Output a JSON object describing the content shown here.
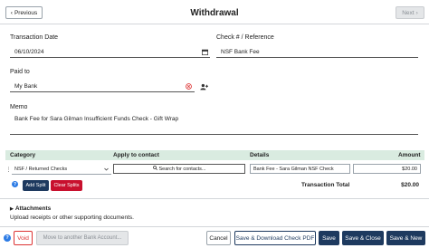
{
  "header": {
    "previous_label": "Previous",
    "title": "Withdrawal",
    "next_label": "Next"
  },
  "form": {
    "transaction_date_label": "Transaction Date",
    "transaction_date_value": "06/10/2024",
    "check_label": "Check # / Reference",
    "check_value": "NSF Bank Fee",
    "paid_to_label": "Paid to",
    "paid_to_value": "My Bank",
    "memo_label": "Memo",
    "memo_value": "Bank Fee for Sara Gilman Insufficient Funds Check - Gift Wrap"
  },
  "splits": {
    "columns": [
      "Category",
      "Apply to contact",
      "Details",
      "Amount"
    ],
    "rows": [
      {
        "category": "NSF / Returned Checks",
        "contact_placeholder": "Search for contacts...",
        "details": "Bank Fee - Sara Gilman NSF Check",
        "amount": "$20.00"
      }
    ],
    "add_split_label": "Add Split",
    "clear_splits_label": "Clear Splits",
    "total_label": "Transaction Total",
    "total_value": "$20.00"
  },
  "attachments": {
    "title": "Attachments",
    "hint": "Upload receipts or other supporting documents."
  },
  "footer": {
    "void_label": "Void",
    "move_label": "Move to another Bank Account...",
    "cancel_label": "Cancel",
    "save_download_label": "Save & Download Check PDF",
    "save_label": "Save",
    "save_close_label": "Save & Close",
    "save_new_label": "Save & New"
  },
  "colors": {
    "accent": "#1e3a5f",
    "table_header_bg": "#d9ebe0",
    "danger": "#d33333",
    "clear_splits_bg": "#c8102e"
  }
}
